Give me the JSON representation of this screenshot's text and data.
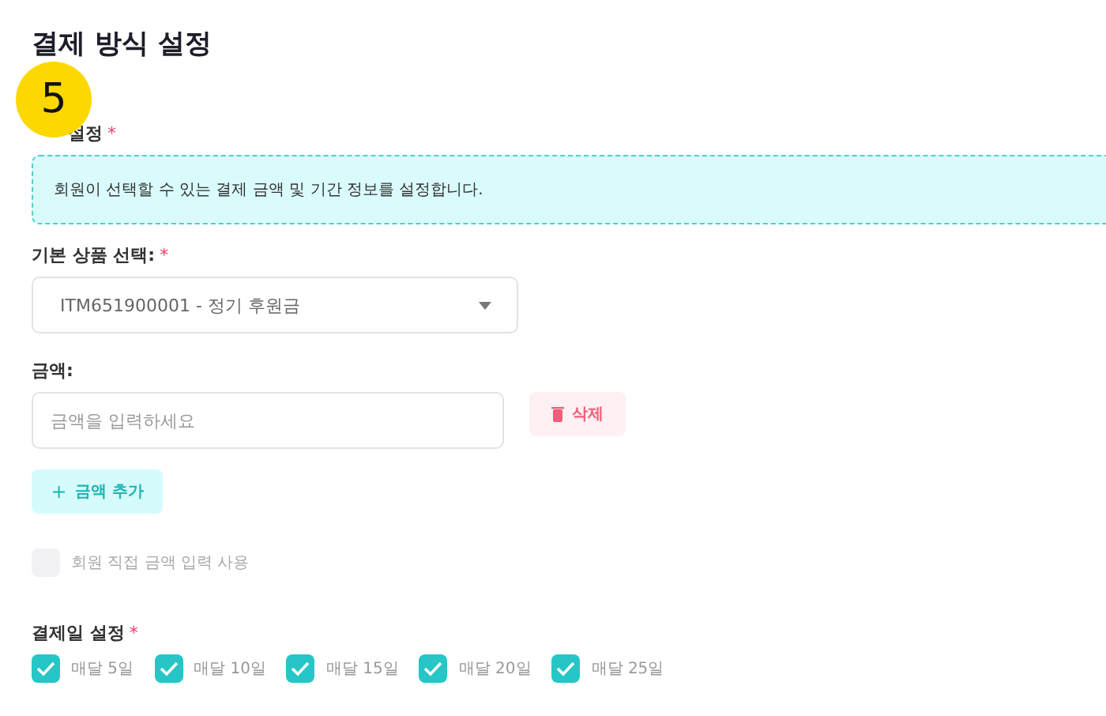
{
  "title": "결제 방식 설정",
  "step_badge": "5",
  "amount_section": {
    "label": "설정",
    "required_mark": "*",
    "info": "회원이 선택할 수 있는 결제 금액 및 기간 정보를 설정합니다."
  },
  "product": {
    "label": "기본 상품 선택:",
    "required_mark": "*",
    "value": "ITM651900001 - 정기 후원금"
  },
  "amount": {
    "label": "금액:",
    "placeholder": "금액을 입력하세요",
    "delete_button": "삭제",
    "add_button": "금액 추가",
    "add_icon": "+"
  },
  "custom_amount": {
    "label": "회원 직접 금액 입력 사용",
    "checked": false
  },
  "payment_days": {
    "label": "결제일 설정",
    "required_mark": "*",
    "options": [
      {
        "label": "매달 5일",
        "checked": true
      },
      {
        "label": "매달 10일",
        "checked": true
      },
      {
        "label": "매달 15일",
        "checked": true
      },
      {
        "label": "매달 20일",
        "checked": true
      },
      {
        "label": "매달 25일",
        "checked": true
      }
    ]
  }
}
